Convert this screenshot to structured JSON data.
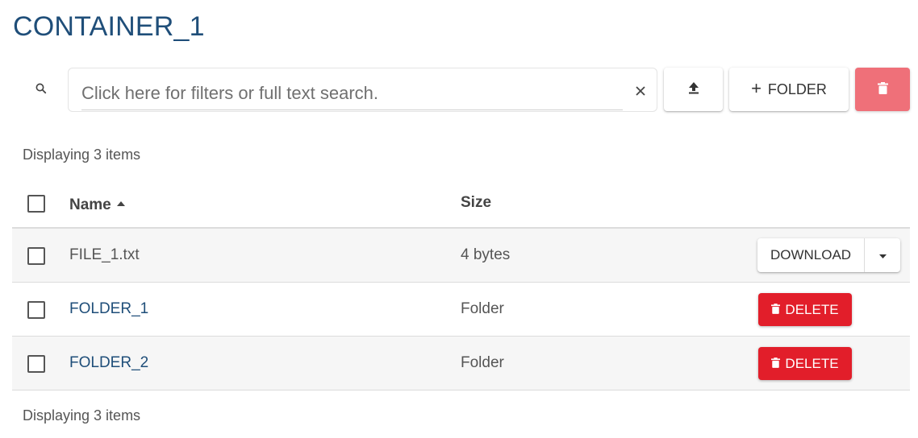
{
  "header": {
    "title": "CONTAINER_1"
  },
  "toolbar": {
    "search_placeholder": "Click here for filters or full text search.",
    "search_value": "",
    "folder_label": "FOLDER",
    "icons": {
      "search": "search-icon",
      "clear": "close-icon",
      "upload": "upload-icon",
      "add": "plus-icon",
      "delete_selected": "trash-icon"
    }
  },
  "listing": {
    "count_text_top": "Displaying 3 items",
    "count_text_bottom": "Displaying 3 items",
    "columns": {
      "name": "Name",
      "size": "Size"
    },
    "sort": {
      "column": "name",
      "direction": "ascending"
    },
    "rows": [
      {
        "name": "FILE_1.txt",
        "size": "4 bytes",
        "type": "file",
        "action": "DOWNLOAD"
      },
      {
        "name": "FOLDER_1",
        "size": "Folder",
        "type": "folder",
        "action": "DELETE"
      },
      {
        "name": "FOLDER_2",
        "size": "Folder",
        "type": "folder",
        "action": "DELETE"
      }
    ]
  },
  "colors": {
    "title": "#1f4e79",
    "link": "#1f4e79",
    "delete": "#e21e2a",
    "delete_selected": "#ef7079"
  }
}
